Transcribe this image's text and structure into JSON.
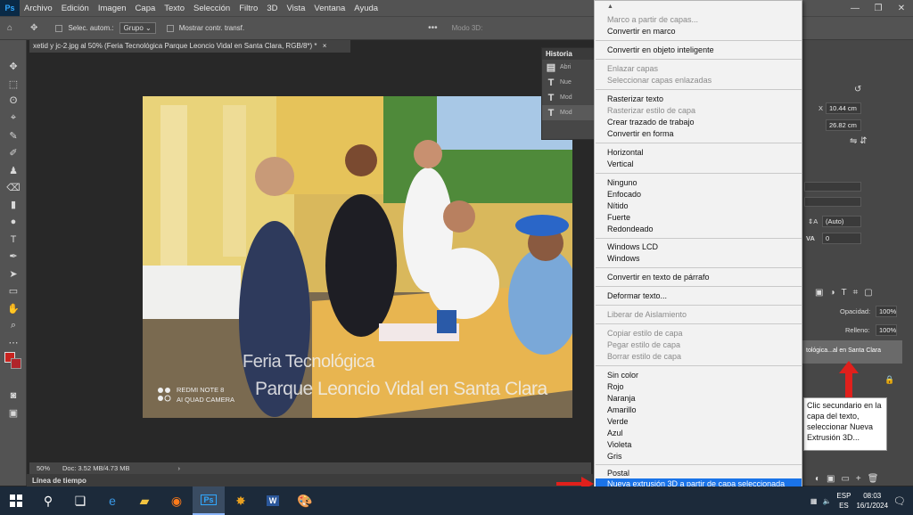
{
  "menubar": {
    "logo": "Ps",
    "items": [
      "Archivo",
      "Edición",
      "Imagen",
      "Capa",
      "Texto",
      "Selección",
      "Filtro",
      "3D",
      "Vista",
      "Ventana",
      "Ayuda"
    ],
    "win_controls": [
      "—",
      "❐",
      "✕"
    ]
  },
  "options": {
    "auto_select": "Selec. autom.:",
    "group_value": "Grupo",
    "show_transform": "Mostrar contr. transf.",
    "mode3d": "Modo 3D:"
  },
  "document": {
    "tab_title": "xetid y jc-2.jpg al 50% (Feria Tecnológica Parque Leoncio Vidal en Santa Clara, RGB/8*) *",
    "close": "×"
  },
  "photo": {
    "watermark_line1": "Feria Tecnológica",
    "watermark_line2": "Parque Leoncio Vidal en Santa Clara",
    "camera_line1": "REDMI NOTE 8",
    "camera_line2": "AI QUAD CAMERA"
  },
  "history": {
    "title": "Historia",
    "rows": [
      {
        "icon": "▤",
        "label": "Abri"
      },
      {
        "icon": "T",
        "label": "Nue"
      },
      {
        "icon": "T",
        "label": "Mod"
      },
      {
        "icon": "T",
        "label": "Mod"
      }
    ]
  },
  "status": {
    "zoom": "50%",
    "doc": "Doc: 3.52 MB/4.73 MB",
    "more": "›"
  },
  "timeline": {
    "label": "Línea de tiempo"
  },
  "right_panel": {
    "x_label": "X",
    "x_value": "10.44 cm",
    "y_value": "26.82 cm",
    "leading_value": "(Auto)",
    "tracking_label": "VA",
    "tracking_value": "0",
    "opacity_label": "Opacidad:",
    "opacity_value": "100%",
    "fill_label": "Relleno:",
    "fill_value": "100%",
    "layer_name": "tológica...al en Santa Clara"
  },
  "annotation": {
    "text": "Clic secundario en la capa del texto, seleccionar Nueva Extrusión 3D..."
  },
  "context_menu": {
    "up_arrow": "▲",
    "down_arrow": "▼",
    "highlighted": "Nueva extrusión 3D a partir de capa seleccionada",
    "items": [
      {
        "label": "Marco a partir de capas...",
        "disabled": true
      },
      {
        "label": "Convertir en marco",
        "disabled": false
      },
      {
        "label": "Convertir en objeto inteligente",
        "disabled": false
      },
      {
        "label": "Enlazar capas",
        "disabled": true
      },
      {
        "label": "Seleccionar capas enlazadas",
        "disabled": true
      },
      {
        "label": "Rasterizar texto",
        "disabled": false
      },
      {
        "label": "Rasterizar estilo de capa",
        "disabled": true
      },
      {
        "label": "Crear trazado de trabajo",
        "disabled": false
      },
      {
        "label": "Convertir en forma",
        "disabled": false
      },
      {
        "label": "Horizontal",
        "disabled": false
      },
      {
        "label": "Vertical",
        "disabled": false
      },
      {
        "label": "Ninguno",
        "disabled": false
      },
      {
        "label": "Enfocado",
        "disabled": false
      },
      {
        "label": "Nítido",
        "disabled": false
      },
      {
        "label": "Fuerte",
        "disabled": false
      },
      {
        "label": "Redondeado",
        "disabled": false
      },
      {
        "label": "Windows LCD",
        "disabled": false
      },
      {
        "label": "Windows",
        "disabled": false
      },
      {
        "label": "Convertir en texto de párrafo",
        "disabled": false
      },
      {
        "label": "Deformar texto...",
        "disabled": false
      },
      {
        "label": "Liberar de Aislamiento",
        "disabled": true
      },
      {
        "label": "Copiar estilo de capa",
        "disabled": true
      },
      {
        "label": "Pegar estilo de capa",
        "disabled": true
      },
      {
        "label": "Borrar estilo de capa",
        "disabled": true
      },
      {
        "label": "Sin color",
        "disabled": false
      },
      {
        "label": "Rojo",
        "disabled": false
      },
      {
        "label": "Naranja",
        "disabled": false
      },
      {
        "label": "Amarillo",
        "disabled": false
      },
      {
        "label": "Verde",
        "disabled": false
      },
      {
        "label": "Azul",
        "disabled": false
      },
      {
        "label": "Violeta",
        "disabled": false
      },
      {
        "label": "Gris",
        "disabled": false
      },
      {
        "label": "Postal",
        "disabled": false
      }
    ]
  },
  "taskbar": {
    "lang_top": "ESP",
    "lang_bottom": "ES",
    "time": "08:03",
    "date": "16/1/2024"
  },
  "colors": {
    "foreground": "#c8231f",
    "highlight": "#1a73e8",
    "annotation_arrow": "#e0201c"
  }
}
